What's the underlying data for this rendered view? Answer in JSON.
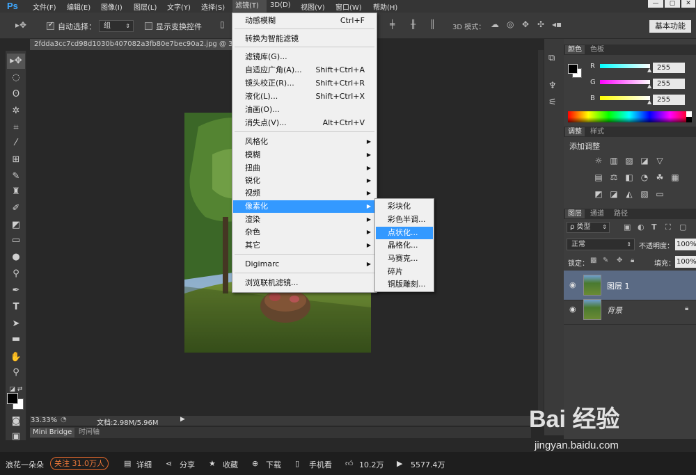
{
  "app": {
    "logo": "Ps"
  },
  "menubar": {
    "items": [
      "文件(F)",
      "编辑(E)",
      "图像(I)",
      "图层(L)",
      "文字(Y)",
      "选择(S)",
      "滤镜(T)",
      "3D(D)",
      "视图(V)",
      "窗口(W)",
      "帮助(H)"
    ],
    "window_controls": [
      "—",
      "▢",
      "✕"
    ]
  },
  "options": {
    "auto_select_label": "自动选择：",
    "auto_select_value": "组",
    "show_transform_label": "显示变换控件",
    "mode_3d_label": "3D 模式：",
    "workspace": "基本功能"
  },
  "document": {
    "tab_title": "2fdda3cc7cd98d1030b407082a3fb80e7bec90a2.jpg @ 33",
    "zoom": "33.33%",
    "doc_info": "文档:2.98M/5.96M"
  },
  "bottom_tabs": [
    "Mini Bridge",
    "时间轴"
  ],
  "filter_menu": {
    "items": [
      {
        "label": "动感模糊",
        "shortcut": "Ctrl+F"
      },
      {
        "label": "转换为智能滤镜",
        "shortcut": ""
      },
      {
        "label": "滤镜库(G)...",
        "shortcut": ""
      },
      {
        "label": "自适应广角(A)...",
        "shortcut": "Shift+Ctrl+A"
      },
      {
        "label": "镜头校正(R)...",
        "shortcut": "Shift+Ctrl+R"
      },
      {
        "label": "液化(L)...",
        "shortcut": "Shift+Ctrl+X"
      },
      {
        "label": "油画(O)...",
        "shortcut": ""
      },
      {
        "label": "消失点(V)...",
        "shortcut": "Alt+Ctrl+V"
      },
      {
        "label": "风格化",
        "shortcut": ""
      },
      {
        "label": "模糊",
        "shortcut": ""
      },
      {
        "label": "扭曲",
        "shortcut": ""
      },
      {
        "label": "锐化",
        "shortcut": ""
      },
      {
        "label": "视频",
        "shortcut": ""
      },
      {
        "label": "像素化",
        "shortcut": ""
      },
      {
        "label": "渲染",
        "shortcut": ""
      },
      {
        "label": "杂色",
        "shortcut": ""
      },
      {
        "label": "其它",
        "shortcut": ""
      },
      {
        "label": "Digimarc",
        "shortcut": ""
      },
      {
        "label": "浏览联机滤镜...",
        "shortcut": ""
      }
    ],
    "highlighted": "像素化"
  },
  "pixelate_submenu": {
    "items": [
      "彩块化",
      "彩色半调...",
      "点状化...",
      "晶格化...",
      "马赛克...",
      "碎片",
      "铜版雕刻..."
    ],
    "highlighted": "点状化..."
  },
  "color_panel": {
    "tabs": [
      "颜色",
      "色板"
    ],
    "channels": [
      {
        "name": "R",
        "value": "255"
      },
      {
        "name": "G",
        "value": "255"
      },
      {
        "name": "B",
        "value": "255"
      }
    ]
  },
  "adjust_panel": {
    "tabs": [
      "调整",
      "样式"
    ],
    "title": "添加调整"
  },
  "layers_panel": {
    "tabs": [
      "图层",
      "通道",
      "路径"
    ],
    "kind_filter": "ρ 类型",
    "blend_mode": "正常",
    "opacity_label": "不透明度：",
    "opacity": "100%",
    "lock_label": "锁定：",
    "fill_label": "填充：",
    "fill": "100%",
    "layers": [
      {
        "name": "图层 1",
        "locked": false,
        "selected": true
      },
      {
        "name": "背景",
        "locked": true,
        "selected": false
      }
    ]
  },
  "baidu_bar": {
    "author": "浪花一朵朵",
    "follow": "关注 31.0万人",
    "detail": "详细",
    "share": "分享",
    "collect": "收藏",
    "download": "下载",
    "phone": "手机看",
    "likes": "10.2万",
    "views": "5577.4万"
  },
  "watermark": {
    "brand": "Bai 经验",
    "url": "jingyan.baidu.com"
  },
  "colors": {
    "highlight": "#3399ff",
    "ps_blue": "#3ea8ff",
    "follow_orange": "#e86a2c"
  }
}
